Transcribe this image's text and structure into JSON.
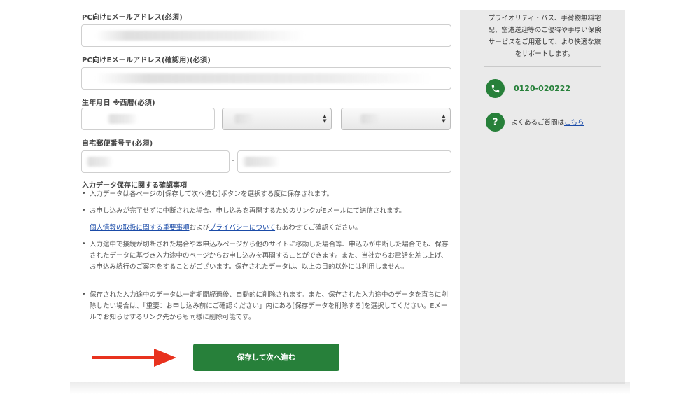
{
  "form": {
    "email_label": "PC向けEメールアドレス(必須)",
    "email_confirm_label": "PC向けEメールアドレス(確認用)(必須)",
    "birthdate_label": "生年月日 ※西暦(必須)",
    "postal_label": "自宅郵便番号〒(必須)",
    "postal_separator": "-",
    "select_arrows": "▲▼"
  },
  "notes": {
    "title": "入力データ保存に関する確認事項",
    "bullet": "•",
    "item1": "入力データは各ページの[保存して次へ進む]ボタンを選択する度に保存されます。",
    "item2": "お申し込みが完了せずに中断された場合、申し込みを再開するためのリンクがEメールにて送信されます。",
    "privacy_link1": "個人情報の取扱に関する重要事項",
    "privacy_and": "および",
    "privacy_link2": "プライバシーについて",
    "privacy_suffix": "もあわせてご確認ください。",
    "item3": "入力途中で接続が切断された場合や本申込みページから他のサイトに移動した場合等、申込みが中断した場合でも、保存されたデータに基づき入力途中のページからお申し込みを再開することができます。また、当社からお電話を差し上げ、お申込み続行のご案内をすることがございます。保存されたデータは、以上の目的以外には利用しません。",
    "item4": "保存された入力途中のデータは一定期間経過後、自動的に削除されます。また、保存された入力途中のデータを直ちに削除したい場合は、「重要：お申し込み前にご確認ください」内にある[保存データを削除する]を選択してください。Eメールでお知らせするリンク先からも同様に削除可能です。"
  },
  "submit_label": "保存して次へ進む",
  "sidebar": {
    "description": "プライオリティ・パス、手荷物無料宅配、空港送迎等のご優待や手厚い保険サービスをご用意して、より快適な旅をサポートします。",
    "phone_number": "0120-020222",
    "phone_icon_glyph": "✆",
    "faq_icon_glyph": "?",
    "faq_prefix": "よくあるご質問は",
    "faq_link": "こちら"
  },
  "colors": {
    "accent_green": "#27803a",
    "link_blue": "#1a4ba8",
    "annotation_arrow_red": "#e8321e",
    "sidebar_bg": "#eaeaea"
  },
  "icons": {
    "phone": "phone-icon",
    "faq": "question-icon",
    "arrow": "red-arrow-icon"
  }
}
